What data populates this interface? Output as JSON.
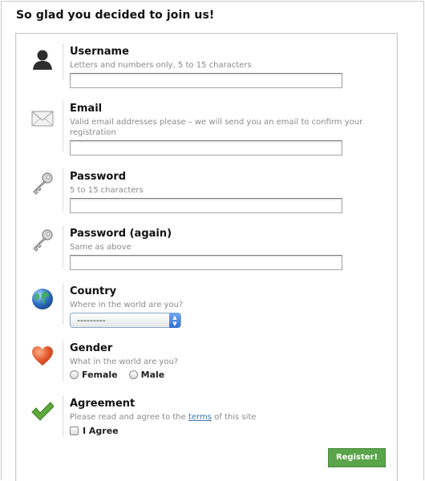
{
  "page": {
    "title": "So glad you decided to join us!"
  },
  "form": {
    "username": {
      "label": "Username",
      "hint": "Letters and numbers only, 5 to 15 characters",
      "value": ""
    },
    "email": {
      "label": "Email",
      "hint": "Valid email addresses please – we will send you an email to confirm your registration",
      "value": ""
    },
    "password": {
      "label": "Password",
      "hint": "5 to 15 characters",
      "value": ""
    },
    "password_again": {
      "label": "Password (again)",
      "hint": "Same as above",
      "value": ""
    },
    "country": {
      "label": "Country",
      "hint": "Where in the world are you?",
      "selected": "---------"
    },
    "gender": {
      "label": "Gender",
      "hint": "What in the world are you?",
      "options": [
        "Female",
        "Male"
      ]
    },
    "agreement": {
      "label": "Agreement",
      "hint_before": "Please read and agree to the ",
      "link": "terms",
      "hint_after": " of this site",
      "checkbox_label": "I Agree"
    },
    "submit_label": "Register!"
  },
  "icons": {
    "username": "user-icon",
    "email": "envelope-icon",
    "password": "key-icon",
    "password_again": "key-icon",
    "country": "globe-icon",
    "gender": "heart-icon",
    "agreement": "checkmark-icon"
  },
  "colors": {
    "button": "#5aa44a",
    "link": "#3d73b8",
    "heart": "#e2572c",
    "check": "#5ea83a",
    "globe": "#2e6fc4"
  }
}
